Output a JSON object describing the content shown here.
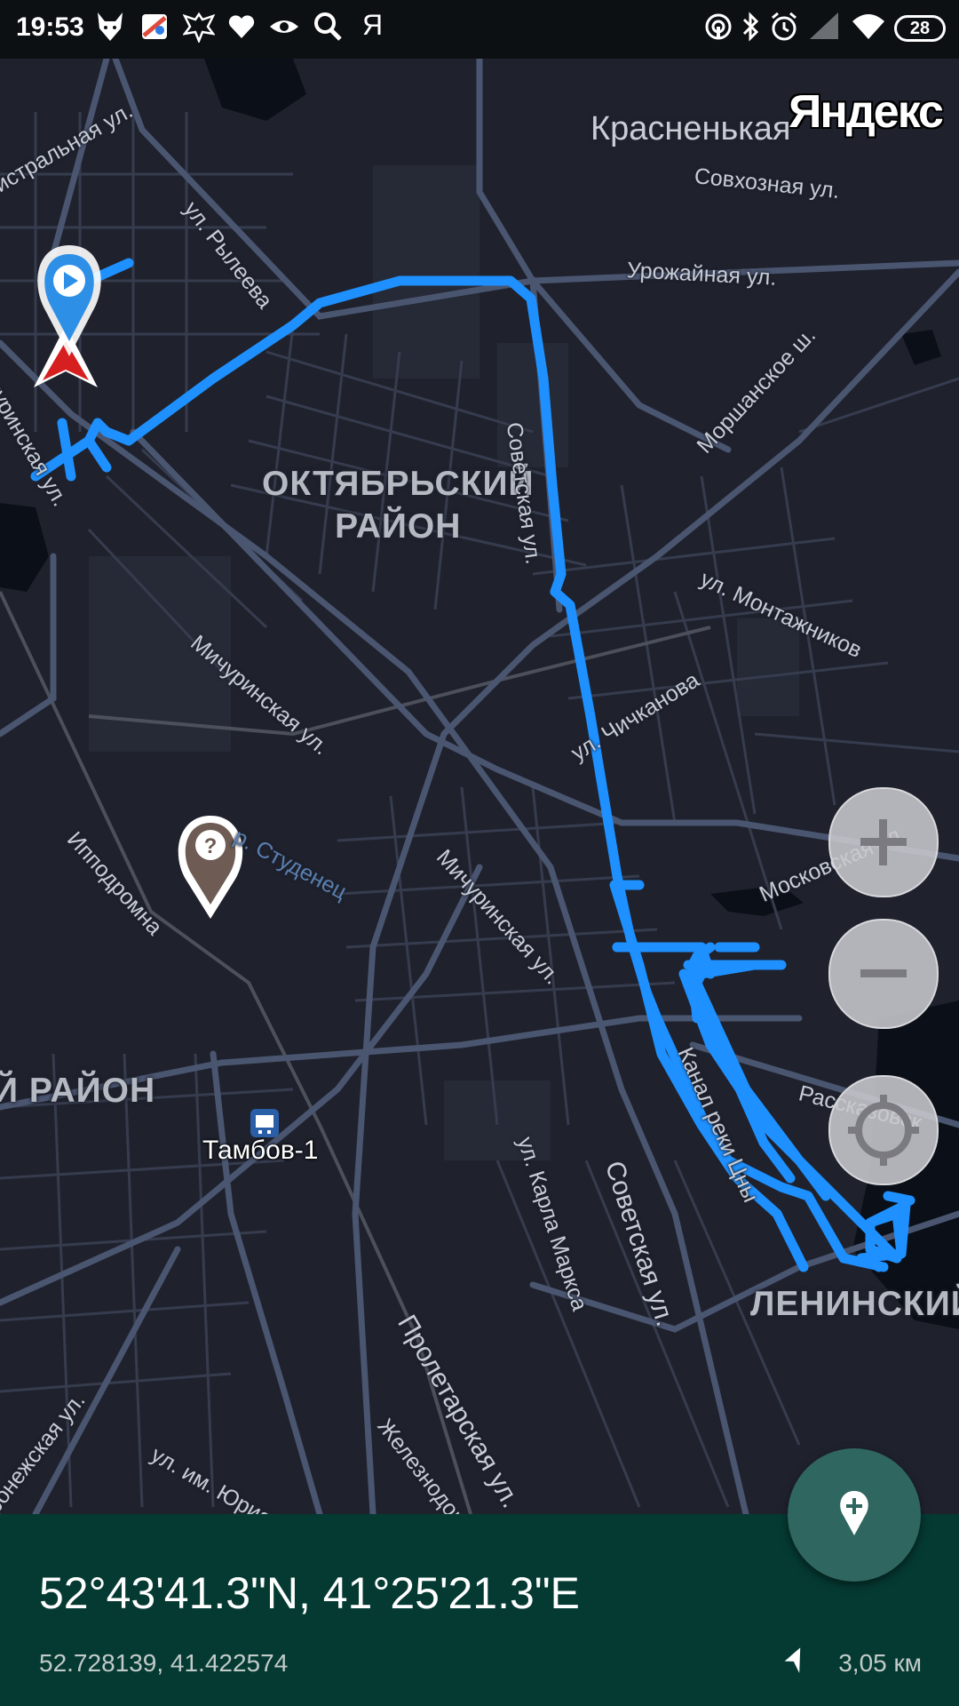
{
  "status_bar": {
    "time": "19:53",
    "left_icons": [
      "fox-icon",
      "maps-app-icon",
      "eagle-emblem-icon",
      "heart-icon",
      "eye-icon",
      "search-icon",
      "yandex-icon"
    ],
    "yandex_letter": "Я",
    "right_icons": [
      "hotspot-icon",
      "bluetooth-icon",
      "alarm-icon",
      "signal-icon",
      "wifi-icon"
    ],
    "battery": "28"
  },
  "map": {
    "brand": "Яндекс",
    "town": "Красненькая",
    "districts": [
      {
        "id": "oktyabrsky",
        "text": "ОКТЯБРЬСКИЙ\nРАЙОН"
      },
      {
        "id": "partial",
        "text": "Й РАЙОН"
      },
      {
        "id": "leninsky",
        "text": "ЛЕНИНСКИЙ"
      }
    ],
    "streets": {
      "tsentralnaya": "истральная ул.",
      "ryleeva": "ул. Рылеева",
      "sovkhoznaya": "Совхозная ул.",
      "urozhaynaya": "Урожайная ул.",
      "morshanskoe": "Моршанское ш.",
      "sovetskaya_top": "Советская ул.",
      "michurinskaya_top": "чуринская ул.",
      "montazhnikov": "ул. Монтажников",
      "michurinskaya_mid": "Мичуринская ул.",
      "chichkanova": "ул. Чичканова",
      "ippodromnaya": "Ипподромна",
      "studenets": "р. Студенец",
      "michurinskaya_low": "Мичуринская ул.",
      "moskovskaya": "Московская ул.",
      "kanal": "Канал реки Цны",
      "rasskazovskoe": "Рассказовск",
      "karla_marksa": "ул. Карла Маркса",
      "sovetskaya_low": "Советская ул.",
      "proletarskaya": "Пролетарская ул.",
      "zheleznodorozhnaya": "Железнодорожная ул.",
      "gagarina": "ул. им. Юрия Гагарина",
      "voronezhskaya": "ронежская ул."
    },
    "station": "Тамбов-1",
    "markers": [
      "play-pin-icon",
      "red-arrow-marker-icon",
      "unknown-poi-pin-icon"
    ],
    "buttons": {
      "zoom_in": "zoom-in-button",
      "zoom_out": "zoom-out-button",
      "locate": "my-location-button"
    },
    "track_color": "#1e90ff"
  },
  "panel": {
    "coords_dms": "52°43'41.3\"N, 41°25'21.3\"E",
    "coords_decimal": "52.728139, 41.422574",
    "distance": "3,05 км",
    "background": "#053a33"
  },
  "fab": {
    "icon": "add-location-icon"
  }
}
